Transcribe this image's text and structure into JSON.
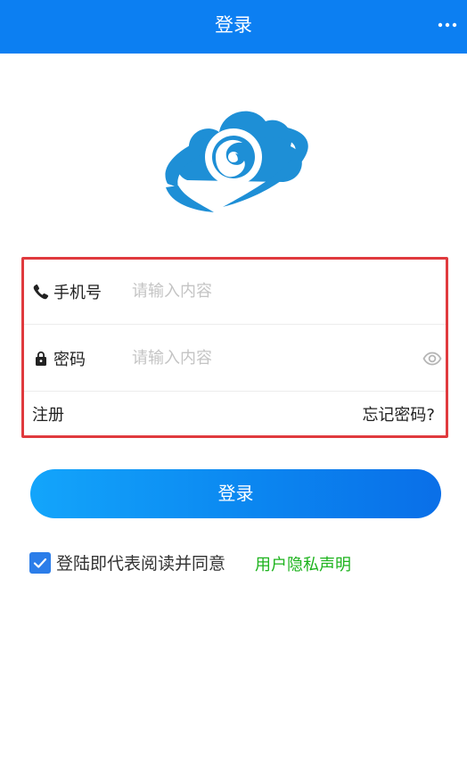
{
  "colors": {
    "nav_background": "#0c7ff2",
    "accent_blue": "#0b86f0",
    "highlight_border": "#e03a3e",
    "link_green": "#1db31d",
    "logo_blue": "#1e8fd6"
  },
  "header": {
    "title": "登录",
    "more_icon": "more-dots-icon"
  },
  "logo": {
    "icon": "cloud-swirl-logo"
  },
  "form": {
    "phone": {
      "icon": "phone-icon",
      "label": "手机号",
      "placeholder": "请输入内容",
      "value": ""
    },
    "password": {
      "icon": "lock-icon",
      "label": "密码",
      "placeholder": "请输入内容",
      "value": "",
      "toggle_icon": "eye-icon"
    },
    "register_label": "注册",
    "forgot_label": "忘记密码?"
  },
  "login_button": {
    "label": "登录"
  },
  "agreement": {
    "checked": true,
    "check_icon": "checkmark-icon",
    "text": "登陆即代表阅读并同意",
    "link_label": "用户隐私声明"
  }
}
